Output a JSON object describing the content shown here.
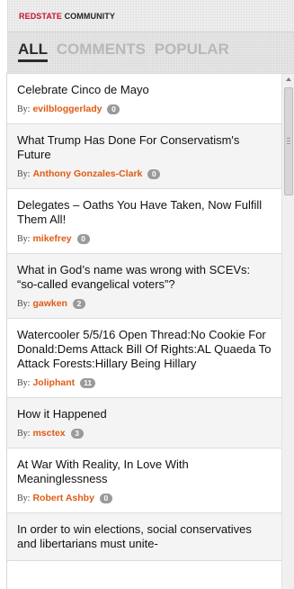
{
  "brand": {
    "part1": "REDSTATE",
    "part2": "COMMUNITY"
  },
  "tabs": [
    {
      "label": "ALL",
      "active": true
    },
    {
      "label": "COMMENTS",
      "active": false
    },
    {
      "label": "POPULAR",
      "active": false
    }
  ],
  "byline_prefix": "By:",
  "items": [
    {
      "title": "Celebrate Cinco de Mayo",
      "author": "evilbloggerlady",
      "comments": "0"
    },
    {
      "title": "What Trump Has Done For Conservatism's Future",
      "author": "Anthony Gonzales-Clark",
      "comments": "0"
    },
    {
      "title": "Delegates – Oaths You Have Taken, Now Fulfill Them All!",
      "author": "mikefrey",
      "comments": "0"
    },
    {
      "title": "What in God’s name was wrong with SCEVs: “so-called evangelical voters”?",
      "author": "gawken",
      "comments": "2"
    },
    {
      "title": "Watercooler 5/5/16 Open Thread:No Cookie For Donald:Dems Attack Bill Of Rights:AL Quaeda To Attack Forests:Hillary Being Hillary",
      "author": "Joliphant",
      "comments": "11"
    },
    {
      "title": "How it Happened",
      "author": "msctex",
      "comments": "3"
    },
    {
      "title": "At War With Reality, In Love With Meaninglessness",
      "author": "Robert Ashby",
      "comments": "0"
    },
    {
      "title": "In order to win elections, social conservatives and libertarians must unite-",
      "author": "",
      "comments": ""
    }
  ]
}
